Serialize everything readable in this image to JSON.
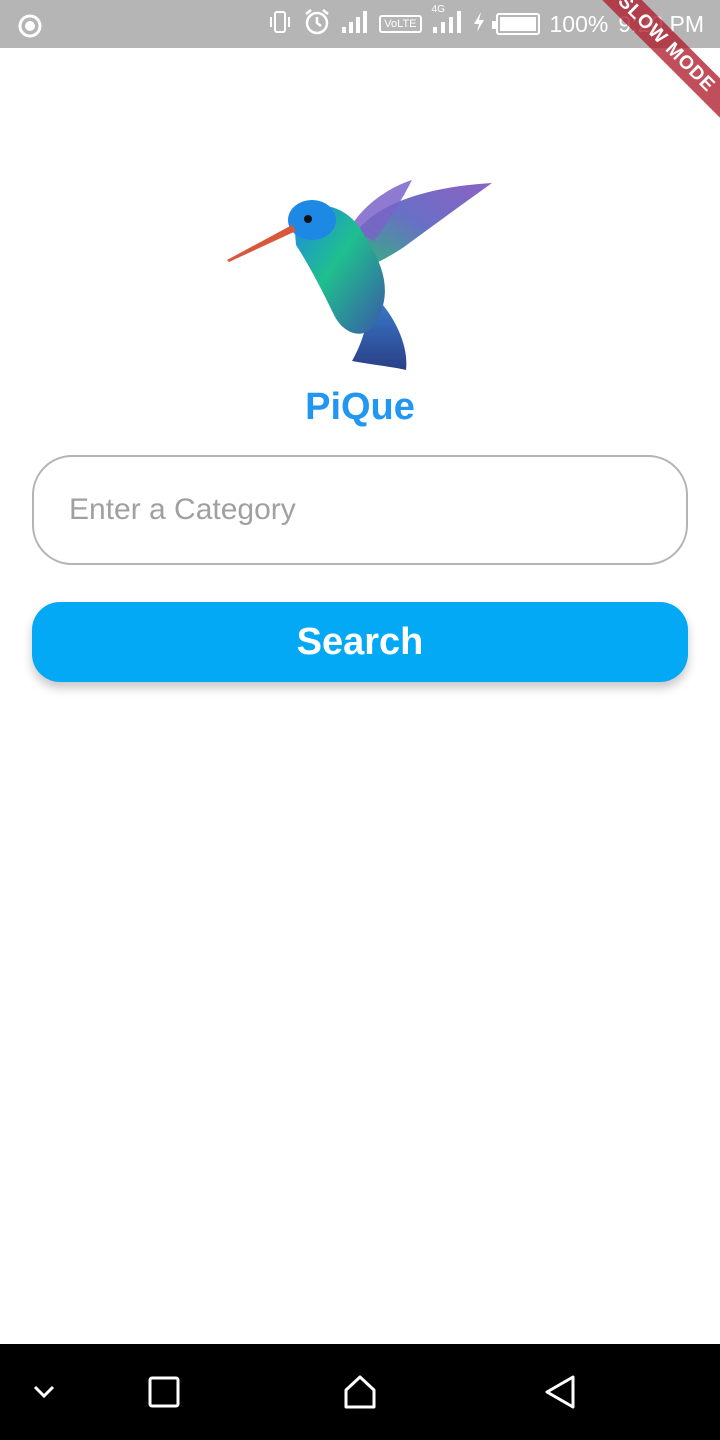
{
  "status_bar": {
    "battery_percent": "100%",
    "time": "9:20 PM",
    "network_label": "VoLTE",
    "network_type": "4G",
    "icons": [
      "record-icon",
      "vibrate-icon",
      "alarm-icon",
      "signal-icon",
      "volte-icon",
      "signal-4g-icon",
      "charging-icon",
      "battery-icon"
    ]
  },
  "debug_ribbon": {
    "label": "SLOW MODE",
    "color": "#b01e2d"
  },
  "app": {
    "title": "PiQue",
    "logo_icon": "hummingbird-logo",
    "title_color": "#2196f3"
  },
  "search": {
    "placeholder": "Enter a Category",
    "value": "",
    "button_label": "Search",
    "button_color": "#03a9f4"
  },
  "nav_bar": {
    "icons": [
      "chevron-down-icon",
      "recents-icon",
      "home-icon",
      "back-icon"
    ]
  }
}
